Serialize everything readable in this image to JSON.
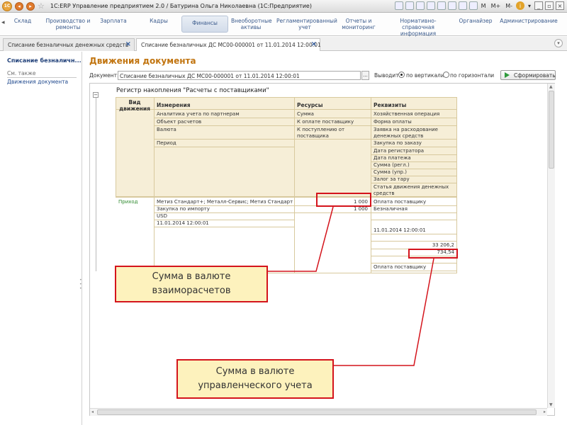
{
  "titlebar": {
    "logo": "1С",
    "title": "1C:ERP Управление предприятием 2.0 / Батурина Ольга Николаевна  (1С:Предприятие)",
    "memory": [
      "M",
      "M+",
      "M-"
    ]
  },
  "sections": [
    {
      "label": "Склад"
    },
    {
      "label": "Производство и ремонты"
    },
    {
      "label": "Зарплата"
    },
    {
      "label": "Кадры"
    },
    {
      "label": "Финансы"
    },
    {
      "label": "Внеоборотные активы"
    },
    {
      "label": "Регламентированный учет"
    },
    {
      "label": "Отчеты и мониторинг"
    },
    {
      "label": "Нормативно-справочная информация"
    },
    {
      "label": "Органайзер"
    },
    {
      "label": "Администрирование"
    }
  ],
  "tabs": [
    {
      "label": "Списание безналичных денежных средств"
    },
    {
      "label": "Списание безналичных ДС МС00-000001 от 11.01.2014 12:00:01"
    }
  ],
  "left_panel": {
    "title": "Списание безналичн...",
    "see_also": "См. также",
    "link": "Движения документа"
  },
  "main": {
    "title": "Движения документа",
    "doc_label": "Документ:",
    "doc_value": "Списание безналичных ДС МС00-000001 от 11.01.2014 12:00:01",
    "pick": "...",
    "output_label": "Выводить:",
    "radio_vertical": "по вертикали",
    "radio_horizontal": "по горизонтали",
    "form_button": "Сформировать"
  },
  "register": {
    "title": "Регистр накопления \"Расчеты с поставщиками\"",
    "headers": {
      "kind": "Вид движения",
      "dimensions": "Измерения",
      "resources": "Ресурсы",
      "attributes": "Реквизиты"
    },
    "dimensions": [
      "Аналитика учета по партнерам",
      "Объект расчетов",
      "Валюта",
      "",
      "Период"
    ],
    "resources": [
      "Сумма",
      "К оплате поставщику",
      "К поступлению от поставщика"
    ],
    "attributes": [
      "Хозяйственная операция",
      "Форма оплаты",
      "Заявка на расходование денежных средств",
      "Закупка по заказу",
      "Дата регистратора",
      "Дата платежа",
      "Сумма (регл.)",
      "Сумма (упр.)",
      "Залог за тару",
      "Статья движения денежных средств"
    ],
    "row": {
      "kind": "Приход",
      "dimensions": [
        "Метиз Стандарт+; Металл-Сервис; Метиз Стандарт+",
        "Закупка по импорту",
        "USD",
        "11.01.2014 12:00:01"
      ],
      "resources": [
        "1 000",
        "1 000",
        ""
      ],
      "attributes": [
        "Оплата поставщику",
        "Безналичная",
        "",
        "",
        "11.01.2014 12:00:01",
        "",
        "33 206,2",
        "734,54",
        "",
        "Оплата поставщику"
      ]
    }
  },
  "callouts": {
    "settlement": "Сумма в валюте взаиморасчетов",
    "management": "Сумма в валюте управленческого учета"
  },
  "colors": {
    "accent_title": "#c1740f",
    "header_bg": "#f6eed7",
    "callout_bg": "#fdf2bd",
    "callout_border": "#d4141c",
    "movement_green": "#2f8a2f"
  }
}
